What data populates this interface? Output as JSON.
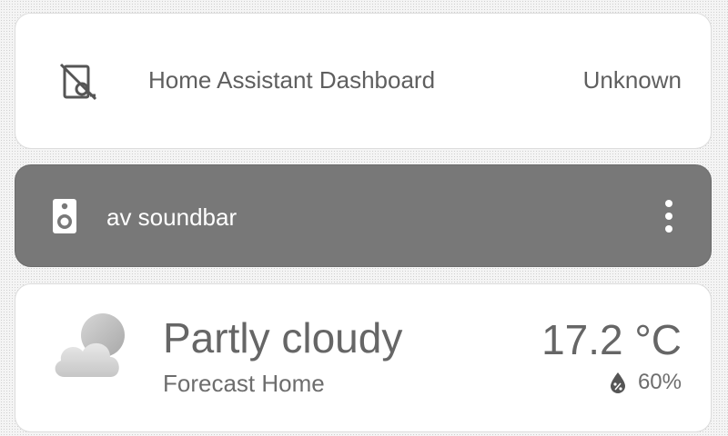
{
  "sensor_card": {
    "icon": "dashboard-off-icon",
    "name": "Home Assistant Dashboard",
    "state": "Unknown"
  },
  "media_card": {
    "icon": "speaker-icon",
    "name": "av soundbar",
    "menu_icon": "more-vertical-icon"
  },
  "weather_card": {
    "icon": "partly-cloudy-icon",
    "condition": "Partly cloudy",
    "location": "Forecast Home",
    "temperature": "17.2 °C",
    "humidity_icon": "water-percent-icon",
    "humidity": "60%"
  },
  "colors": {
    "card_background": "#ffffff",
    "media_card_background": "#787878",
    "text": "#5f5f5f",
    "media_text": "#ffffff"
  }
}
